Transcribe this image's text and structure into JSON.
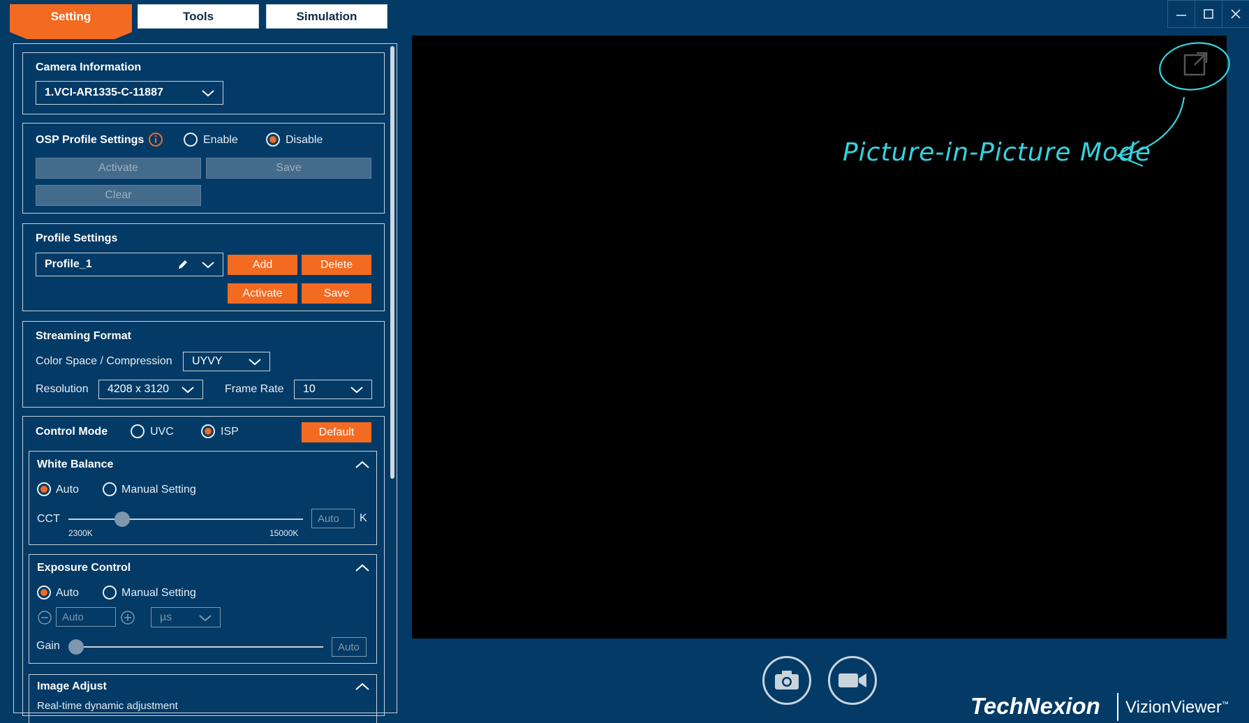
{
  "tabs": [
    {
      "label": "Setting",
      "active": true
    },
    {
      "label": "Tools",
      "active": false
    },
    {
      "label": "Simulation",
      "active": false
    }
  ],
  "camera_info": {
    "title": "Camera Information",
    "selected": "1.VCI-AR1335-C-11887"
  },
  "osp": {
    "title": "OSP Profile Settings",
    "enable_label": "Enable",
    "disable_label": "Disable",
    "selected": "Disable",
    "activate_label": "Activate",
    "save_label": "Save",
    "clear_label": "Clear"
  },
  "profile": {
    "title": "Profile Settings",
    "selected": "Profile_1",
    "add_label": "Add",
    "delete_label": "Delete",
    "activate_label": "Activate",
    "save_label": "Save"
  },
  "streaming": {
    "title": "Streaming Format",
    "color_space_label": "Color Space / Compression",
    "color_space_value": "UYVY",
    "resolution_label": "Resolution",
    "resolution_value": "4208 x 3120",
    "frame_rate_label": "Frame Rate",
    "frame_rate_value": "10"
  },
  "control": {
    "title": "Control Mode",
    "uvc_label": "UVC",
    "isp_label": "ISP",
    "selected": "ISP",
    "default_label": "Default"
  },
  "white_balance": {
    "title": "White Balance",
    "auto_label": "Auto",
    "manual_label": "Manual Setting",
    "selected": "Auto",
    "cct_label": "CCT",
    "min_label": "2300K",
    "max_label": "15000K",
    "value_placeholder": "Auto",
    "unit": "K",
    "slider_fraction": 0.23
  },
  "exposure": {
    "title": "Exposure Control",
    "auto_label": "Auto",
    "manual_label": "Manual Setting",
    "selected": "Auto",
    "value_placeholder": "Auto",
    "unit_value": "µs",
    "gain_label": "Gain",
    "gain_placeholder": "Auto",
    "gain_fraction": 0.0
  },
  "image_adjust": {
    "title": "Image Adjust",
    "subtitle": "Real-time dynamic adjustment"
  },
  "annotation": {
    "pip_text": "Picture-in-Picture Mode",
    "color": "#36d3e0"
  },
  "brand": {
    "company": "TechNexion",
    "product": "VizionViewer",
    "tm": "™"
  },
  "colors": {
    "background": "#033a66",
    "accent": "#f36a21",
    "preview": "#000000"
  }
}
